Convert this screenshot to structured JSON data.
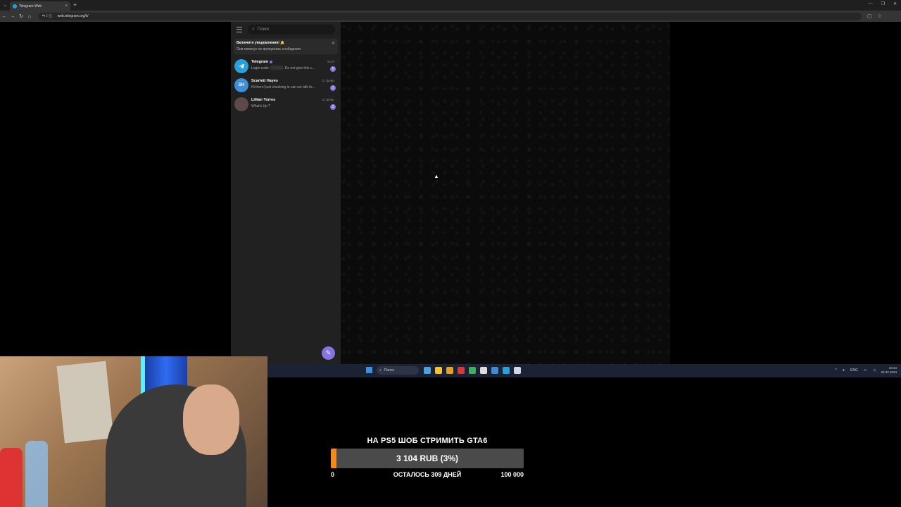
{
  "browser": {
    "tab_title": "Telegram Web",
    "tab_close": "×",
    "new_tab": "+",
    "site_info": "⇆ 𝕀 ◫",
    "url": "web.telegram.org/k/"
  },
  "telegram": {
    "search_placeholder": "Поиск",
    "notification": {
      "title": "Включите уведомления! 🔔",
      "subtitle": "Они помогут не пропускать сообщения."
    },
    "chats": [
      {
        "name": "Telegram",
        "preview": "Login code: ░░░░░. Do not give this c...",
        "time": "16:27",
        "unread": "5",
        "avatar_color": "#2aa0da",
        "initials": ""
      },
      {
        "name": "Scarlett Hayes",
        "preview": "Hi there! just checking in can we talk fo...",
        "time": "21 февр.",
        "unread": "1",
        "avatar_color": "#3d8fd6",
        "initials": "SH"
      },
      {
        "name": "Lillian Torres",
        "preview": "What's Up ?",
        "time": "21 февр.",
        "unread": "2",
        "avatar_color": "#5b4a48",
        "initials": ""
      }
    ],
    "accent_color": "#8774e1"
  },
  "taskbar": {
    "search_label": "Поиск",
    "lang": "ENG",
    "time": "18:44",
    "date": "25.02.2024"
  },
  "donation": {
    "title": "НА PS5 ШОБ СТРИМИТЬ GTA6",
    "amount": "3 104 RUB (3%)",
    "progress": 0.03,
    "min": "0",
    "remaining": "ОСТАЛОСЬ 309 ДНЕЙ",
    "max": "100 000",
    "bar_color": "#f08a1c"
  }
}
